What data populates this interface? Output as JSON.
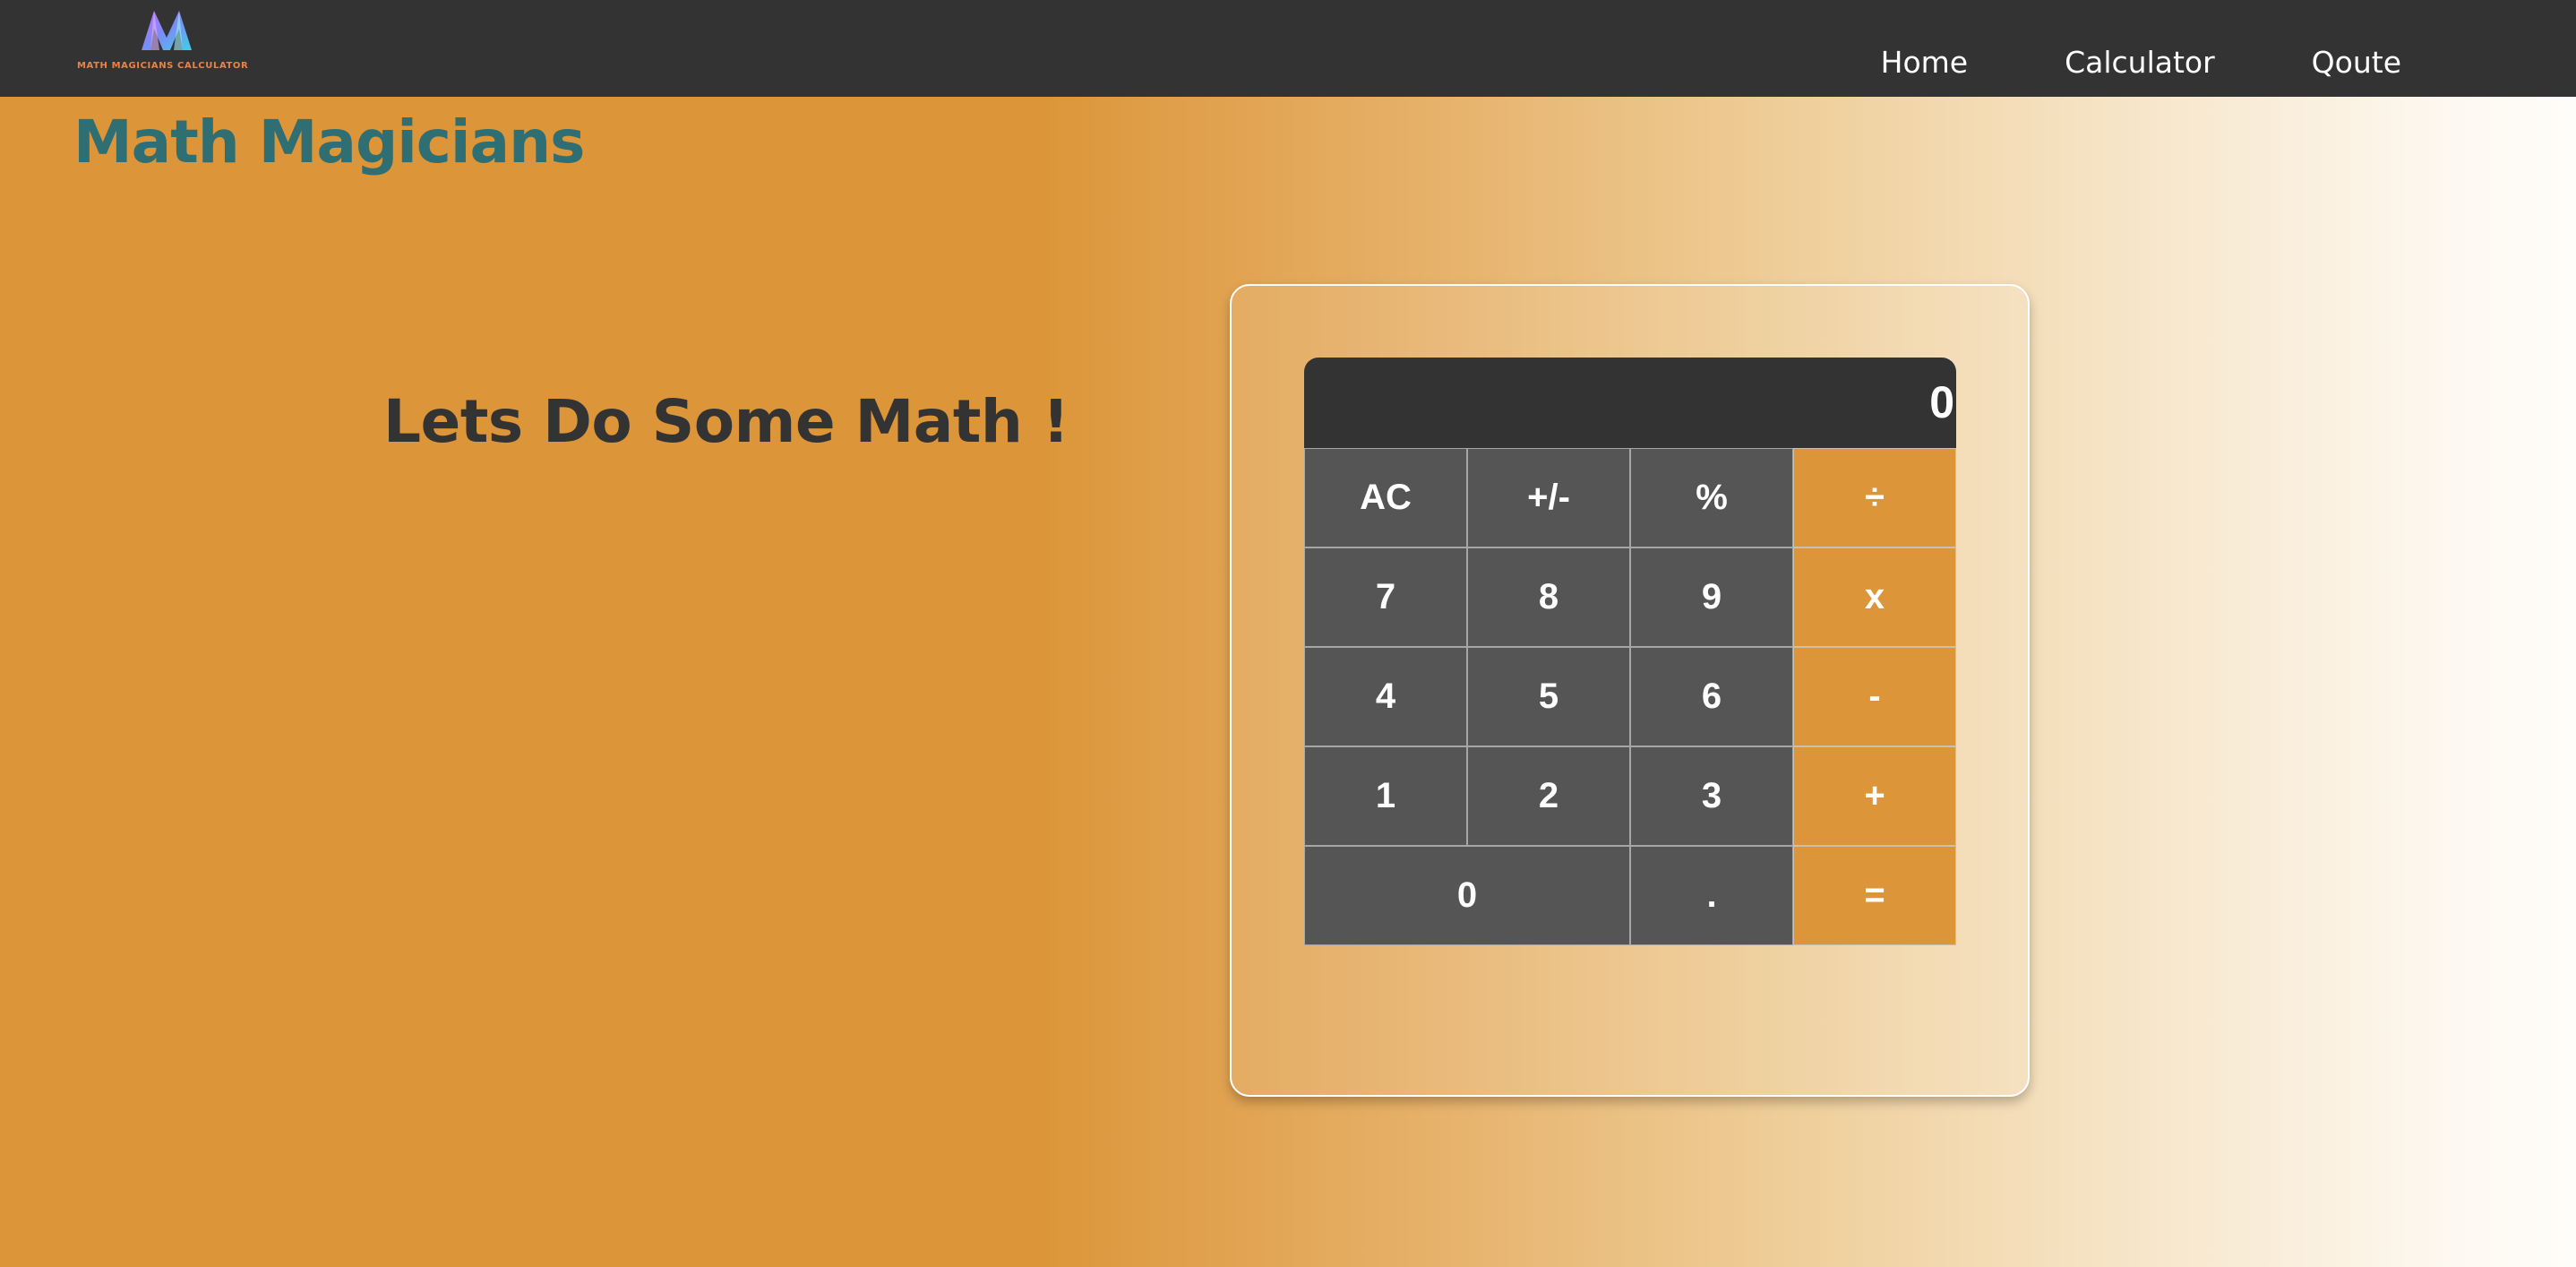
{
  "navbar": {
    "logo_text": "MATH MAGICIANS CALCULATOR",
    "links": [
      {
        "label": "Home"
      },
      {
        "label": "Calculator"
      },
      {
        "label": "Qoute"
      }
    ]
  },
  "brand": {
    "title": "Math Magicians"
  },
  "main": {
    "heading": "Lets Do Some Math !"
  },
  "calculator": {
    "display": "0",
    "keys": [
      {
        "label": "AC",
        "type": "function"
      },
      {
        "label": "+/-",
        "type": "function"
      },
      {
        "label": "%",
        "type": "function"
      },
      {
        "label": "÷",
        "type": "operator"
      },
      {
        "label": "7",
        "type": "digit"
      },
      {
        "label": "8",
        "type": "digit"
      },
      {
        "label": "9",
        "type": "digit"
      },
      {
        "label": "x",
        "type": "operator"
      },
      {
        "label": "4",
        "type": "digit"
      },
      {
        "label": "5",
        "type": "digit"
      },
      {
        "label": "6",
        "type": "digit"
      },
      {
        "label": "-",
        "type": "operator"
      },
      {
        "label": "1",
        "type": "digit"
      },
      {
        "label": "2",
        "type": "digit"
      },
      {
        "label": "3",
        "type": "digit"
      },
      {
        "label": "+",
        "type": "operator"
      },
      {
        "label": "0",
        "type": "digit"
      },
      {
        "label": ".",
        "type": "digit"
      },
      {
        "label": "=",
        "type": "operator"
      }
    ]
  },
  "colors": {
    "navbar": "#333333",
    "accent": "#dc9538",
    "brand_title": "#2f6e73",
    "key_bg": "#555555"
  },
  "icons": {
    "logo": "math-magicians-logo-icon"
  }
}
